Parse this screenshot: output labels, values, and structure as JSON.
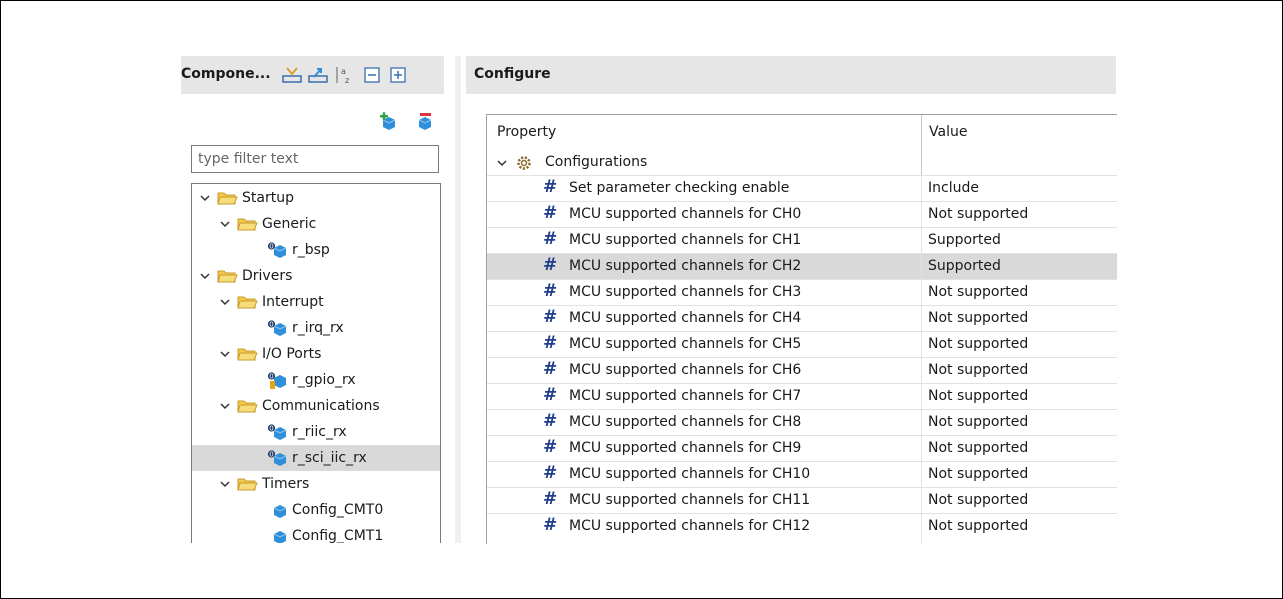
{
  "left_panel": {
    "title": "Compone...",
    "toolbar_icons": [
      "import-icon",
      "export-icon",
      "sort-az-icon",
      "collapse-all-icon",
      "expand-all-icon"
    ],
    "filter_placeholder": "type filter text",
    "tree": [
      {
        "label": "Startup",
        "level": 0,
        "type": "folder",
        "expanded": true
      },
      {
        "label": "Generic",
        "level": 1,
        "type": "folder",
        "expanded": true
      },
      {
        "label": "r_bsp",
        "level": 2,
        "type": "component"
      },
      {
        "label": "Drivers",
        "level": 0,
        "type": "folder",
        "expanded": true
      },
      {
        "label": "Interrupt",
        "level": 1,
        "type": "folder",
        "expanded": true
      },
      {
        "label": "r_irq_rx",
        "level": 2,
        "type": "component"
      },
      {
        "label": "I/O Ports",
        "level": 1,
        "type": "folder",
        "expanded": true
      },
      {
        "label": "r_gpio_rx",
        "level": 2,
        "type": "component-warning"
      },
      {
        "label": "Communications",
        "level": 1,
        "type": "folder",
        "expanded": true
      },
      {
        "label": "r_riic_rx",
        "level": 2,
        "type": "component"
      },
      {
        "label": "r_sci_iic_rx",
        "level": 2,
        "type": "component",
        "selected": true
      },
      {
        "label": "Timers",
        "level": 1,
        "type": "folder",
        "expanded": true
      },
      {
        "label": "Config_CMT0",
        "level": 2,
        "type": "config"
      },
      {
        "label": "Config_CMT1",
        "level": 2,
        "type": "config"
      }
    ]
  },
  "right_panel": {
    "title": "Configure",
    "columns": {
      "property": "Property",
      "value": "Value"
    },
    "group_label": "Configurations",
    "rows": [
      {
        "property": "Set parameter checking enable",
        "value": "Include"
      },
      {
        "property": "MCU supported channels for CH0",
        "value": "Not supported"
      },
      {
        "property": "MCU supported channels for CH1",
        "value": "Supported"
      },
      {
        "property": "MCU supported channels for CH2",
        "value": "Supported",
        "selected": true
      },
      {
        "property": "MCU supported channels for CH3",
        "value": "Not supported"
      },
      {
        "property": "MCU supported channels for CH4",
        "value": "Not supported"
      },
      {
        "property": "MCU supported channels for CH5",
        "value": "Not supported"
      },
      {
        "property": "MCU supported channels for CH6",
        "value": "Not supported"
      },
      {
        "property": "MCU supported channels for CH7",
        "value": "Not supported"
      },
      {
        "property": "MCU supported channels for CH8",
        "value": "Not supported"
      },
      {
        "property": "MCU supported channels for CH9",
        "value": "Not supported"
      },
      {
        "property": "MCU supported channels for CH10",
        "value": "Not supported"
      },
      {
        "property": "MCU supported channels for CH11",
        "value": "Not supported"
      },
      {
        "property": "MCU supported channels for CH12",
        "value": "Not supported"
      }
    ]
  },
  "colors": {
    "folder": "#f2c94c",
    "folder_stroke": "#c99a2e",
    "component": "#2f8fd8",
    "hash": "#1f3d8a",
    "selection": "#d9d9d9",
    "add_green": "#2fa34a",
    "remove_red": "#d9363e"
  }
}
